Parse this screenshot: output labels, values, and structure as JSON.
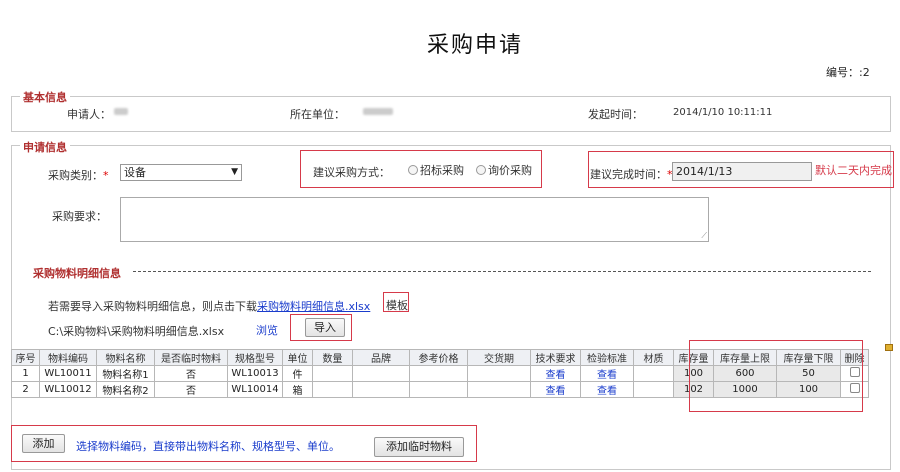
{
  "page_title": "采购申请",
  "serial": {
    "label": "编号：",
    "value": ":2"
  },
  "basic": {
    "legend": "基本信息",
    "applicant_label": "申请人：",
    "applicant_value": "",
    "unit_label": "所在单位：",
    "unit_value": "",
    "time_label": "发起时间：",
    "time_value": "2014/1/10 10:11:11"
  },
  "apply": {
    "legend": "申请信息",
    "category_label": "采购类别：",
    "category_value": "设备",
    "method_label": "建议采购方式：",
    "method_options": [
      "招标采购",
      "询价采购"
    ],
    "deadline_label": "建议完成时间：",
    "deadline_value": "2014/1/13",
    "deadline_note": "默认二天内完成",
    "requirement_label": "采购要求："
  },
  "detail": {
    "title": "采购物料明细信息",
    "download_prefix": "若需要导入采购物料明细信息，则点击下载",
    "download_link": "采购物料明细信息.xlsx",
    "template_word": "模板",
    "file_path": "C:\\采购物料\\采购物料明细信息.xlsx",
    "browse": "浏览",
    "import": "导入"
  },
  "table": {
    "headers": [
      "序号",
      "物料编码",
      "物料名称",
      "是否临时物料",
      "规格型号",
      "单位",
      "数量",
      "品牌",
      "参考价格",
      "交货期",
      "技术要求",
      "检验标准",
      "材质",
      "库存量",
      "库存量上限",
      "库存量下限",
      "删除"
    ],
    "rows": [
      [
        "1",
        "WL10011",
        "物料名称1",
        "否",
        "WL10013",
        "件",
        "",
        "",
        "",
        "",
        "查看",
        "查看",
        "",
        "100",
        "600",
        "50",
        ""
      ],
      [
        "2",
        "WL10012",
        "物料名称2",
        "否",
        "WL10014",
        "箱",
        "",
        "",
        "",
        "",
        "查看",
        "查看",
        "",
        "102",
        "1000",
        "100",
        ""
      ]
    ]
  },
  "footer": {
    "add": "添加",
    "hint": "选择物料编码，直接带出物料名称、规格型号、单位。",
    "add_temp": "添加临时物料"
  }
}
